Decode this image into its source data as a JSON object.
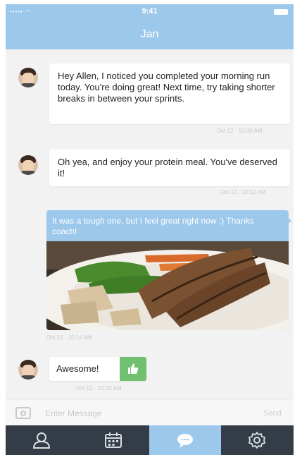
{
  "status_bar": {
    "signal": "••••• ◠",
    "time": "9:41"
  },
  "header": {
    "title": "Jan"
  },
  "messages": [
    {
      "text": "Hey Allen, I noticed you completed your morning run today. You're doing great! Next time, try taking shorter breaks in between your sprints.",
      "timestamp": "Oct 12 · 10:00 AM"
    },
    {
      "text": "Oh yea, and enjoy your protein meal. You've deserved it!",
      "timestamp": "Oct 12 · 10:12 AM"
    },
    {
      "text": "It was a tough one, but I feel great right now :) Thanks coach!",
      "timestamp": "Oct 12 · 10:14 AM"
    },
    {
      "text": "Awesome!",
      "timestamp": "Oct 12 · 10:15 AM"
    }
  ],
  "composer": {
    "placeholder": "Enter Message",
    "send_label": "Send"
  },
  "tabs": [
    {
      "icon": "person-icon"
    },
    {
      "icon": "calendar-icon"
    },
    {
      "icon": "chat-bubble-icon"
    },
    {
      "icon": "gear-icon"
    }
  ],
  "colors": {
    "accent": "#9cc8ec",
    "tabbar": "#343d47",
    "like": "#70c070"
  }
}
